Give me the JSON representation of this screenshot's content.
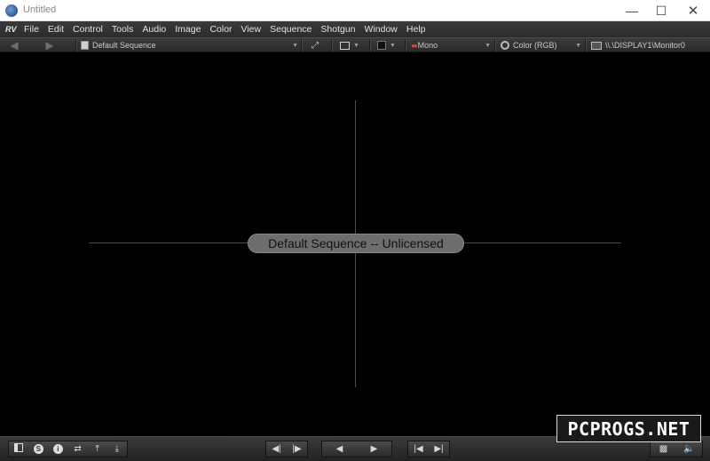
{
  "window": {
    "title": "Untitled",
    "min_glyph": "—",
    "max_glyph": "☐",
    "close_glyph": "✕"
  },
  "menubar": {
    "logo": "RV",
    "items": [
      "File",
      "Edit",
      "Control",
      "Tools",
      "Audio",
      "Image",
      "Color",
      "View",
      "Sequence",
      "Shotgun",
      "Window",
      "Help"
    ]
  },
  "toolbar": {
    "back_icon": "arrow-left-icon",
    "forward_icon": "arrow-right-icon",
    "sequence_selector": "Default Sequence",
    "stereo_mode": "Mono",
    "color_space": "Color (RGB)",
    "display": "\\\\.\\DISPLAY1\\Monitor0"
  },
  "viewport": {
    "status_text": "Default Sequence -- Unlicensed",
    "background": "#000000",
    "crosshair_color": "#4a4a4a"
  },
  "bottombar": {
    "left_icons": [
      "panel-icon",
      "sync-icon",
      "info-icon",
      "swap-icon",
      "upload-icon",
      "download-icon"
    ],
    "step_back": "◀|",
    "step_forward": "|▶",
    "play_back": "◀",
    "play_forward": "▶",
    "goto_start": "|◀",
    "goto_end": "▶|"
  },
  "watermark": {
    "text": "PCPROGS.NET"
  }
}
